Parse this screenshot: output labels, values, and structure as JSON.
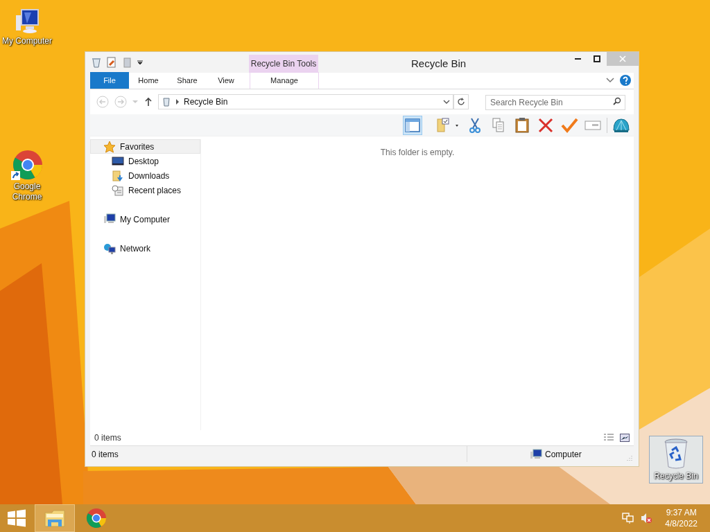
{
  "desktop_icons": [
    {
      "label": "My Computer",
      "kind": "computer",
      "selected": false
    },
    {
      "label": "Google Chrome",
      "kind": "chrome",
      "selected": false
    },
    {
      "label": "Recycle Bin",
      "kind": "recycle",
      "selected": true
    }
  ],
  "window": {
    "title": "Recycle Bin",
    "contextual_group": "Recycle Bin Tools",
    "ribbon_tabs": [
      {
        "label": "File",
        "kind": "file",
        "selected": false
      },
      {
        "label": "Home",
        "kind": "normal",
        "selected": false
      },
      {
        "label": "Share",
        "kind": "normal",
        "selected": false
      },
      {
        "label": "View",
        "kind": "normal",
        "selected": false
      },
      {
        "label": "Manage",
        "kind": "contextual",
        "selected": false
      }
    ],
    "address": "Recycle Bin",
    "search": {
      "placeholder": "Search Recycle Bin"
    },
    "toolbar": [
      {
        "kind": "pane",
        "selected": true
      },
      {
        "kind": "folder-check",
        "selected": false
      },
      {
        "kind": "cut",
        "selected": false
      },
      {
        "kind": "copy",
        "selected": false
      },
      {
        "kind": "paste",
        "selected": false
      },
      {
        "kind": "delete",
        "selected": false
      },
      {
        "kind": "check",
        "selected": false
      },
      {
        "kind": "rename",
        "selected": false
      },
      {
        "kind": "shell",
        "selected": false
      }
    ],
    "navigation": [
      {
        "label": "Favorites",
        "kind": "star",
        "selected": true,
        "children": [
          {
            "label": "Desktop",
            "kind": "desktop",
            "selected": false
          },
          {
            "label": "Downloads",
            "kind": "downloads",
            "selected": false
          },
          {
            "label": "Recent places",
            "kind": "recent",
            "selected": false
          }
        ]
      },
      {
        "label": "My Computer",
        "kind": "computer",
        "selected": false
      },
      {
        "label": "Network",
        "kind": "network",
        "selected": false
      }
    ],
    "empty_message": "This folder is empty.",
    "item_count": "0 items",
    "status_bar": {
      "items": "0 items",
      "location": "Computer"
    }
  },
  "taskbar": {
    "apps": [
      {
        "kind": "explorer",
        "selected": true
      },
      {
        "kind": "chrome",
        "selected": false
      }
    ],
    "time": "9:37 AM",
    "date": "4/8/2022"
  }
}
